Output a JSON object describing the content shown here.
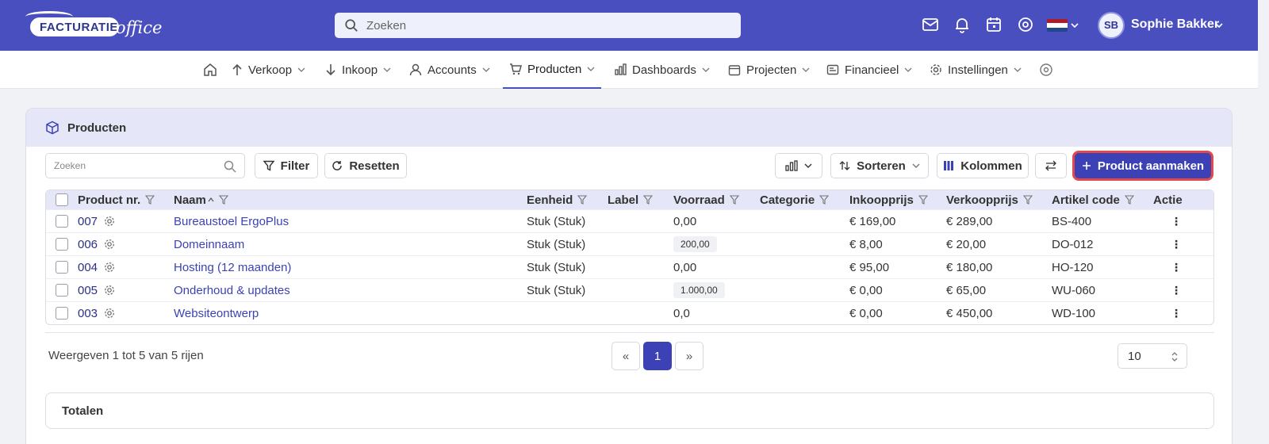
{
  "topbar": {
    "logo_word1": "FACTURATIE",
    "logo_word2": "office",
    "search_placeholder": "Zoeken",
    "user_initials": "SB",
    "user_name": "Sophie Bakker",
    "flag_colors": [
      "#ae1c28",
      "#ffffff",
      "#21468b"
    ]
  },
  "nav": {
    "items": [
      {
        "label": "Verkoop",
        "icon": "arrow-up-icon"
      },
      {
        "label": "Inkoop",
        "icon": "arrow-down-icon"
      },
      {
        "label": "Accounts",
        "icon": "user-icon"
      },
      {
        "label": "Producten",
        "icon": "cart-icon",
        "active": true
      },
      {
        "label": "Dashboards",
        "icon": "bar-chart-icon"
      },
      {
        "label": "Projecten",
        "icon": "calendar-icon"
      },
      {
        "label": "Financieel",
        "icon": "bank-icon"
      },
      {
        "label": "Instellingen",
        "icon": "gear-icon"
      }
    ]
  },
  "card": {
    "title": "Producten"
  },
  "toolbar": {
    "search_placeholder": "Zoeken",
    "filter_label": "Filter",
    "reset_label": "Resetten",
    "sort_label": "Sorteren",
    "columns_label": "Kolommen",
    "create_label": "Product aanmaken"
  },
  "table": {
    "columns": [
      "Product nr.",
      "Naam",
      "Eenheid",
      "Label",
      "Voorraad",
      "Categorie",
      "Inkoopprijs",
      "Verkoopprijs",
      "Artikel code",
      "Actie"
    ],
    "rows": [
      {
        "nr": "007",
        "naam": "Bureaustoel ErgoPlus",
        "eenheid": "Stuk (Stuk)",
        "label": "",
        "voorraad": "0,00",
        "voorraad_badge": false,
        "categorie": "",
        "inkoop": "€ 169,00",
        "verkoop": "€ 289,00",
        "code": "BS-400"
      },
      {
        "nr": "006",
        "naam": "Domeinnaam",
        "eenheid": "Stuk (Stuk)",
        "label": "",
        "voorraad": "200,00",
        "voorraad_badge": true,
        "categorie": "",
        "inkoop": "€ 8,00",
        "verkoop": "€ 20,00",
        "code": "DO-012"
      },
      {
        "nr": "004",
        "naam": "Hosting (12 maanden)",
        "eenheid": "Stuk (Stuk)",
        "label": "",
        "voorraad": "0,00",
        "voorraad_badge": false,
        "categorie": "",
        "inkoop": "€ 95,00",
        "verkoop": "€ 180,00",
        "code": "HO-120"
      },
      {
        "nr": "005",
        "naam": "Onderhoud & updates",
        "eenheid": "Stuk (Stuk)",
        "label": "",
        "voorraad": "1.000,00",
        "voorraad_badge": true,
        "categorie": "",
        "inkoop": "€ 0,00",
        "verkoop": "€ 65,00",
        "code": "WU-060"
      },
      {
        "nr": "003",
        "naam": "Websiteontwerp",
        "eenheid": "",
        "label": "",
        "voorraad": "0,0",
        "voorraad_badge": false,
        "categorie": "",
        "inkoop": "€ 0,00",
        "verkoop": "€ 450,00",
        "code": "WD-100"
      }
    ]
  },
  "footer": {
    "summary": "Weergeven 1 tot 5 van 5 rijen",
    "prev": "«",
    "page": "1",
    "next": "»",
    "page_size": "10"
  },
  "totals": {
    "title": "Totalen"
  },
  "colors": {
    "brand": "#4a4fc0",
    "primary": "#3c42b5",
    "highlight": "#e24a4a"
  }
}
